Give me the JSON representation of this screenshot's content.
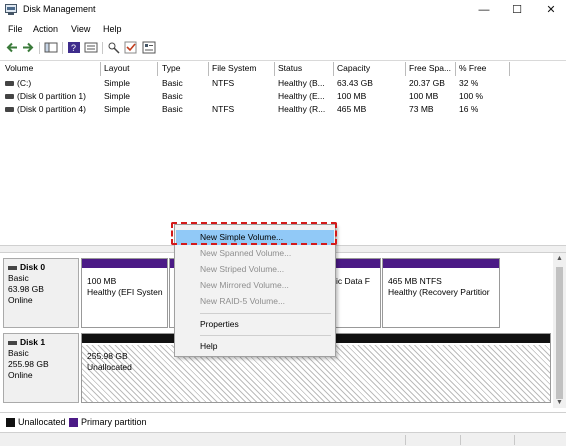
{
  "window": {
    "title": "Disk Management",
    "minimize_glyph": "—",
    "maximize_glyph": "☐",
    "close_glyph": "✕"
  },
  "menu": [
    "File",
    "Action",
    "View",
    "Help"
  ],
  "toolbar": {
    "icons": [
      "back-arrow-icon",
      "forward-arrow-icon",
      "console-tree-icon",
      "help-icon",
      "properties-icon",
      "connect-icon",
      "check-icon",
      "list-view-icon"
    ]
  },
  "columns": [
    "Volume",
    "Layout",
    "Type",
    "File System",
    "Status",
    "Capacity",
    "Free Spa...",
    "% Free"
  ],
  "volumes": [
    [
      "(C:)",
      "Simple",
      "Basic",
      "NTFS",
      "Healthy (B...",
      "63.43 GB",
      "20.37 GB",
      "32 %"
    ],
    [
      "(Disk 0 partition 1)",
      "Simple",
      "Basic",
      "",
      "Healthy (E...",
      "100 MB",
      "100 MB",
      "100 %"
    ],
    [
      "(Disk 0 partition 4)",
      "Simple",
      "Basic",
      "NTFS",
      "Healthy (R...",
      "465 MB",
      "73 MB",
      "16 %"
    ]
  ],
  "disks": [
    {
      "name": "Disk 0",
      "kind": "Basic",
      "size": "63.98 GB",
      "state": "Online",
      "partitions": [
        {
          "size": "100 MB",
          "status": "Healthy (EFI Systen"
        },
        {
          "size": "",
          "status": "asic Data F"
        },
        {
          "size": "465 MB NTFS",
          "status": "Healthy (Recovery Partitior"
        }
      ]
    },
    {
      "name": "Disk 1",
      "kind": "Basic",
      "size": "255.98 GB",
      "state": "Online",
      "partitions": [
        {
          "size": "255.98 GB",
          "status": "Unallocated"
        }
      ]
    }
  ],
  "legend": [
    {
      "label": "Unallocated",
      "color": "#111111"
    },
    {
      "label": "Primary partition",
      "color": "#4b1a86"
    }
  ],
  "context_menu": {
    "items": [
      {
        "label": "New Simple Volume...",
        "state": "highlighted"
      },
      {
        "label": "New Spanned Volume...",
        "state": "disabled"
      },
      {
        "label": "New Striped Volume...",
        "state": "disabled"
      },
      {
        "label": "New Mirrored Volume...",
        "state": "disabled"
      },
      {
        "label": "New RAID-5 Volume...",
        "state": "disabled"
      },
      {
        "label": "Properties",
        "state": "enabled"
      },
      {
        "label": "Help",
        "state": "enabled"
      }
    ]
  },
  "colors": {
    "primary_partition": "#4b1a86",
    "unallocated": "#111111",
    "menu_highlight": "#91c9f7",
    "annotation_red": "#d41a1a"
  }
}
